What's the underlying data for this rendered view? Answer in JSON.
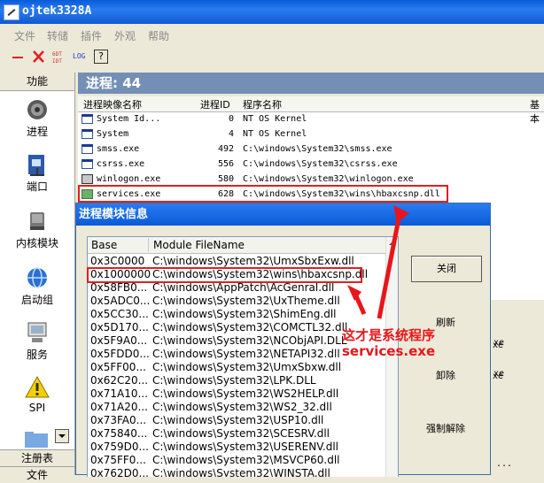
{
  "window": {
    "title": "ojtek3328A"
  },
  "menu": [
    "文件",
    "转储",
    "插件",
    "外观",
    "帮助"
  ],
  "toolbar": {
    "log_label": "LOG",
    "help_label": "?"
  },
  "sidebar": {
    "header": "功能",
    "items": [
      {
        "label": "进程",
        "icon": "gear-icon"
      },
      {
        "label": "端口",
        "icon": "network-icon"
      },
      {
        "label": "内核模块",
        "icon": "disk-icon"
      },
      {
        "label": "启动组",
        "icon": "globe-icon"
      },
      {
        "label": "服务",
        "icon": "computer-icon"
      },
      {
        "label": "SPI",
        "icon": "warning-icon"
      }
    ],
    "footer_tabs": [
      "注册表",
      "文件"
    ]
  },
  "main": {
    "header": "进程: 44",
    "columns": [
      "进程映像名称",
      "进程ID",
      "程序名称",
      "基本"
    ],
    "rows": [
      {
        "name": "System Id...",
        "pid": "0",
        "path": "NT OS Kernel"
      },
      {
        "name": "System",
        "pid": "4",
        "path": "NT OS Kernel"
      },
      {
        "name": "smss.exe",
        "pid": "492",
        "path": "C:\\windows\\System32\\smss.exe"
      },
      {
        "name": "csrss.exe",
        "pid": "556",
        "path": "C:\\windows\\System32\\csrss.exe"
      },
      {
        "name": "winlogon.exe",
        "pid": "580",
        "path": "C:\\windows\\System32\\winlogon.exe"
      },
      {
        "name": "services.exe",
        "pid": "628",
        "path": "C:\\windows\\System32\\wins\\hbaxcsnp.dll"
      }
    ],
    "right_fragments": [
      "xe",
      "xe",
      "..."
    ]
  },
  "dialog": {
    "title": "进程模块信息",
    "columns": [
      "Base",
      "Module FileName"
    ],
    "rows": [
      {
        "base": "0x3C0000",
        "file": "C:\\windows\\System32\\UmxSbxExw.dll"
      },
      {
        "base": "0x1000000",
        "file": "C:\\windows\\System32\\wins\\hbaxcsnp.dll"
      },
      {
        "base": "0x58FB0...",
        "file": "C:\\windows\\AppPatch\\AcGenral.dll"
      },
      {
        "base": "0x5ADC0...",
        "file": "C:\\windows\\System32\\UxTheme.dll"
      },
      {
        "base": "0x5CC30...",
        "file": "C:\\windows\\System32\\ShimEng.dll"
      },
      {
        "base": "0x5D170...",
        "file": "C:\\windows\\System32\\COMCTL32.dll"
      },
      {
        "base": "0x5F9A0...",
        "file": "C:\\windows\\System32\\NCObjAPI.DLL"
      },
      {
        "base": "0x5FDD0...",
        "file": "C:\\windows\\System32\\NETAPI32.dll"
      },
      {
        "base": "0x5FF00...",
        "file": "C:\\windows\\System32\\UmxSbxw.dll"
      },
      {
        "base": "0x62C20...",
        "file": "C:\\windows\\System32\\LPK.DLL"
      },
      {
        "base": "0x71A10...",
        "file": "C:\\windows\\System32\\WS2HELP.dll"
      },
      {
        "base": "0x71A20...",
        "file": "C:\\windows\\System32\\WS2_32.dll"
      },
      {
        "base": "0x73FA0...",
        "file": "C:\\windows\\System32\\USP10.dll"
      },
      {
        "base": "0x75840...",
        "file": "C:\\windows\\System32\\SCESRV.dll"
      },
      {
        "base": "0x759D0...",
        "file": "C:\\windows\\System32\\USERENV.dll"
      },
      {
        "base": "0x75FF0...",
        "file": "C:\\windows\\System32\\MSVCP60.dll"
      },
      {
        "base": "0x762D0...",
        "file": "C:\\windows\\System32\\WINSTA.dll"
      }
    ],
    "buttons": {
      "close": "关闭",
      "refresh": "刷新",
      "unload": "卸除",
      "force_unload": "强制解除"
    }
  },
  "annotation": {
    "line1": "这才是系统程序",
    "line2": "services.exe"
  },
  "colors": {
    "titlebar": "#0a5ad8",
    "header": "#748fb5",
    "highlight": "#e02020"
  }
}
